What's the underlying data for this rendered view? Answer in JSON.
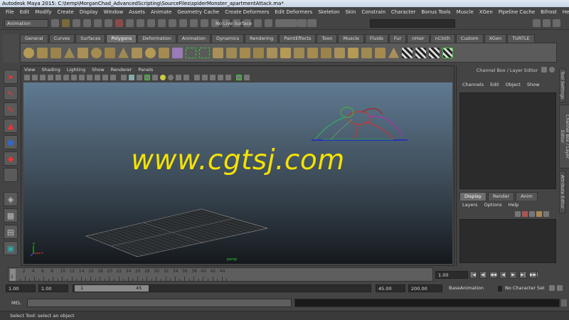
{
  "window": {
    "title": "Autodesk Maya 2015: C:\\temp\\MorganChad_AdvancedScripting\\SourceFiles\\spiderMonster_apartmentAttack.ma*"
  },
  "menubar": [
    "File",
    "Edit",
    "Modify",
    "Create",
    "Display",
    "Window",
    "Assets",
    "Animate",
    "Geometry Cache",
    "Create Deformers",
    "Edit Deformers",
    "Skeleton",
    "Skin",
    "Constrain",
    "Character",
    "Bonus Tools",
    "Muscle",
    "XGen",
    "Pipeline Cache",
    "Bifrost",
    "Help"
  ],
  "statusline": {
    "menu_set": "Animation",
    "live_surface": "No Live Surface"
  },
  "shelf": {
    "tabs": [
      "General",
      "Curves",
      "Surfaces",
      "Polygons",
      "Deformation",
      "Animation",
      "Dynamics",
      "Rendering",
      "PaintEffects",
      "Toon",
      "Muscle",
      "Fluids",
      "Fur",
      "nHair",
      "nCloth",
      "Custom",
      "XGen",
      "TURTLE"
    ],
    "active_tab": "Polygons"
  },
  "panel": {
    "menus": [
      "View",
      "Shading",
      "Lighting",
      "Show",
      "Renderer",
      "Panels"
    ]
  },
  "viewport": {
    "watermark": "www.cgtsj.com",
    "axis": {
      "x": "x",
      "y": "y",
      "z": "z"
    },
    "grid_label": "persp"
  },
  "channel_box": {
    "title": "Channel Box / Layer Editor",
    "menus": [
      "Channels",
      "Edit",
      "Object",
      "Show"
    ]
  },
  "layer_editor": {
    "tabs": [
      "Display",
      "Render",
      "Anim"
    ],
    "active_tab": "Display",
    "menus": [
      "Layers",
      "Options",
      "Help"
    ]
  },
  "side_tabs": [
    "Tool Settings",
    "Channel Box / Layer Editor",
    "Attribute Editor"
  ],
  "timeslider": {
    "ticks": [
      "2",
      "4",
      "6",
      "8",
      "10",
      "12",
      "14",
      "16",
      "18",
      "20",
      "22",
      "24",
      "26",
      "28",
      "30",
      "32",
      "34",
      "36",
      "38",
      "40",
      "42",
      "44"
    ],
    "current_frame_marker": "1",
    "current_frame": "1.00"
  },
  "playback_buttons": [
    "|◀",
    "◀|",
    "◀◀",
    "◀",
    "▶",
    "▶|",
    "▶▶|"
  ],
  "range": {
    "start_time": "1.00",
    "playback_start": "1.00",
    "range_in": "1",
    "range_out": "45",
    "playback_end": "45.00",
    "end_time": "200.00",
    "anim_layer": "BaseAnimation",
    "character_set": "No Character Set"
  },
  "command_line": {
    "label": "MEL"
  },
  "help_line": {
    "text": "Select Tool: select an object"
  },
  "colors": {
    "watermark": "#f5e200",
    "ui_bg": "#444444",
    "viewport_top": "#5f7a91",
    "viewport_bottom": "#15191d"
  }
}
